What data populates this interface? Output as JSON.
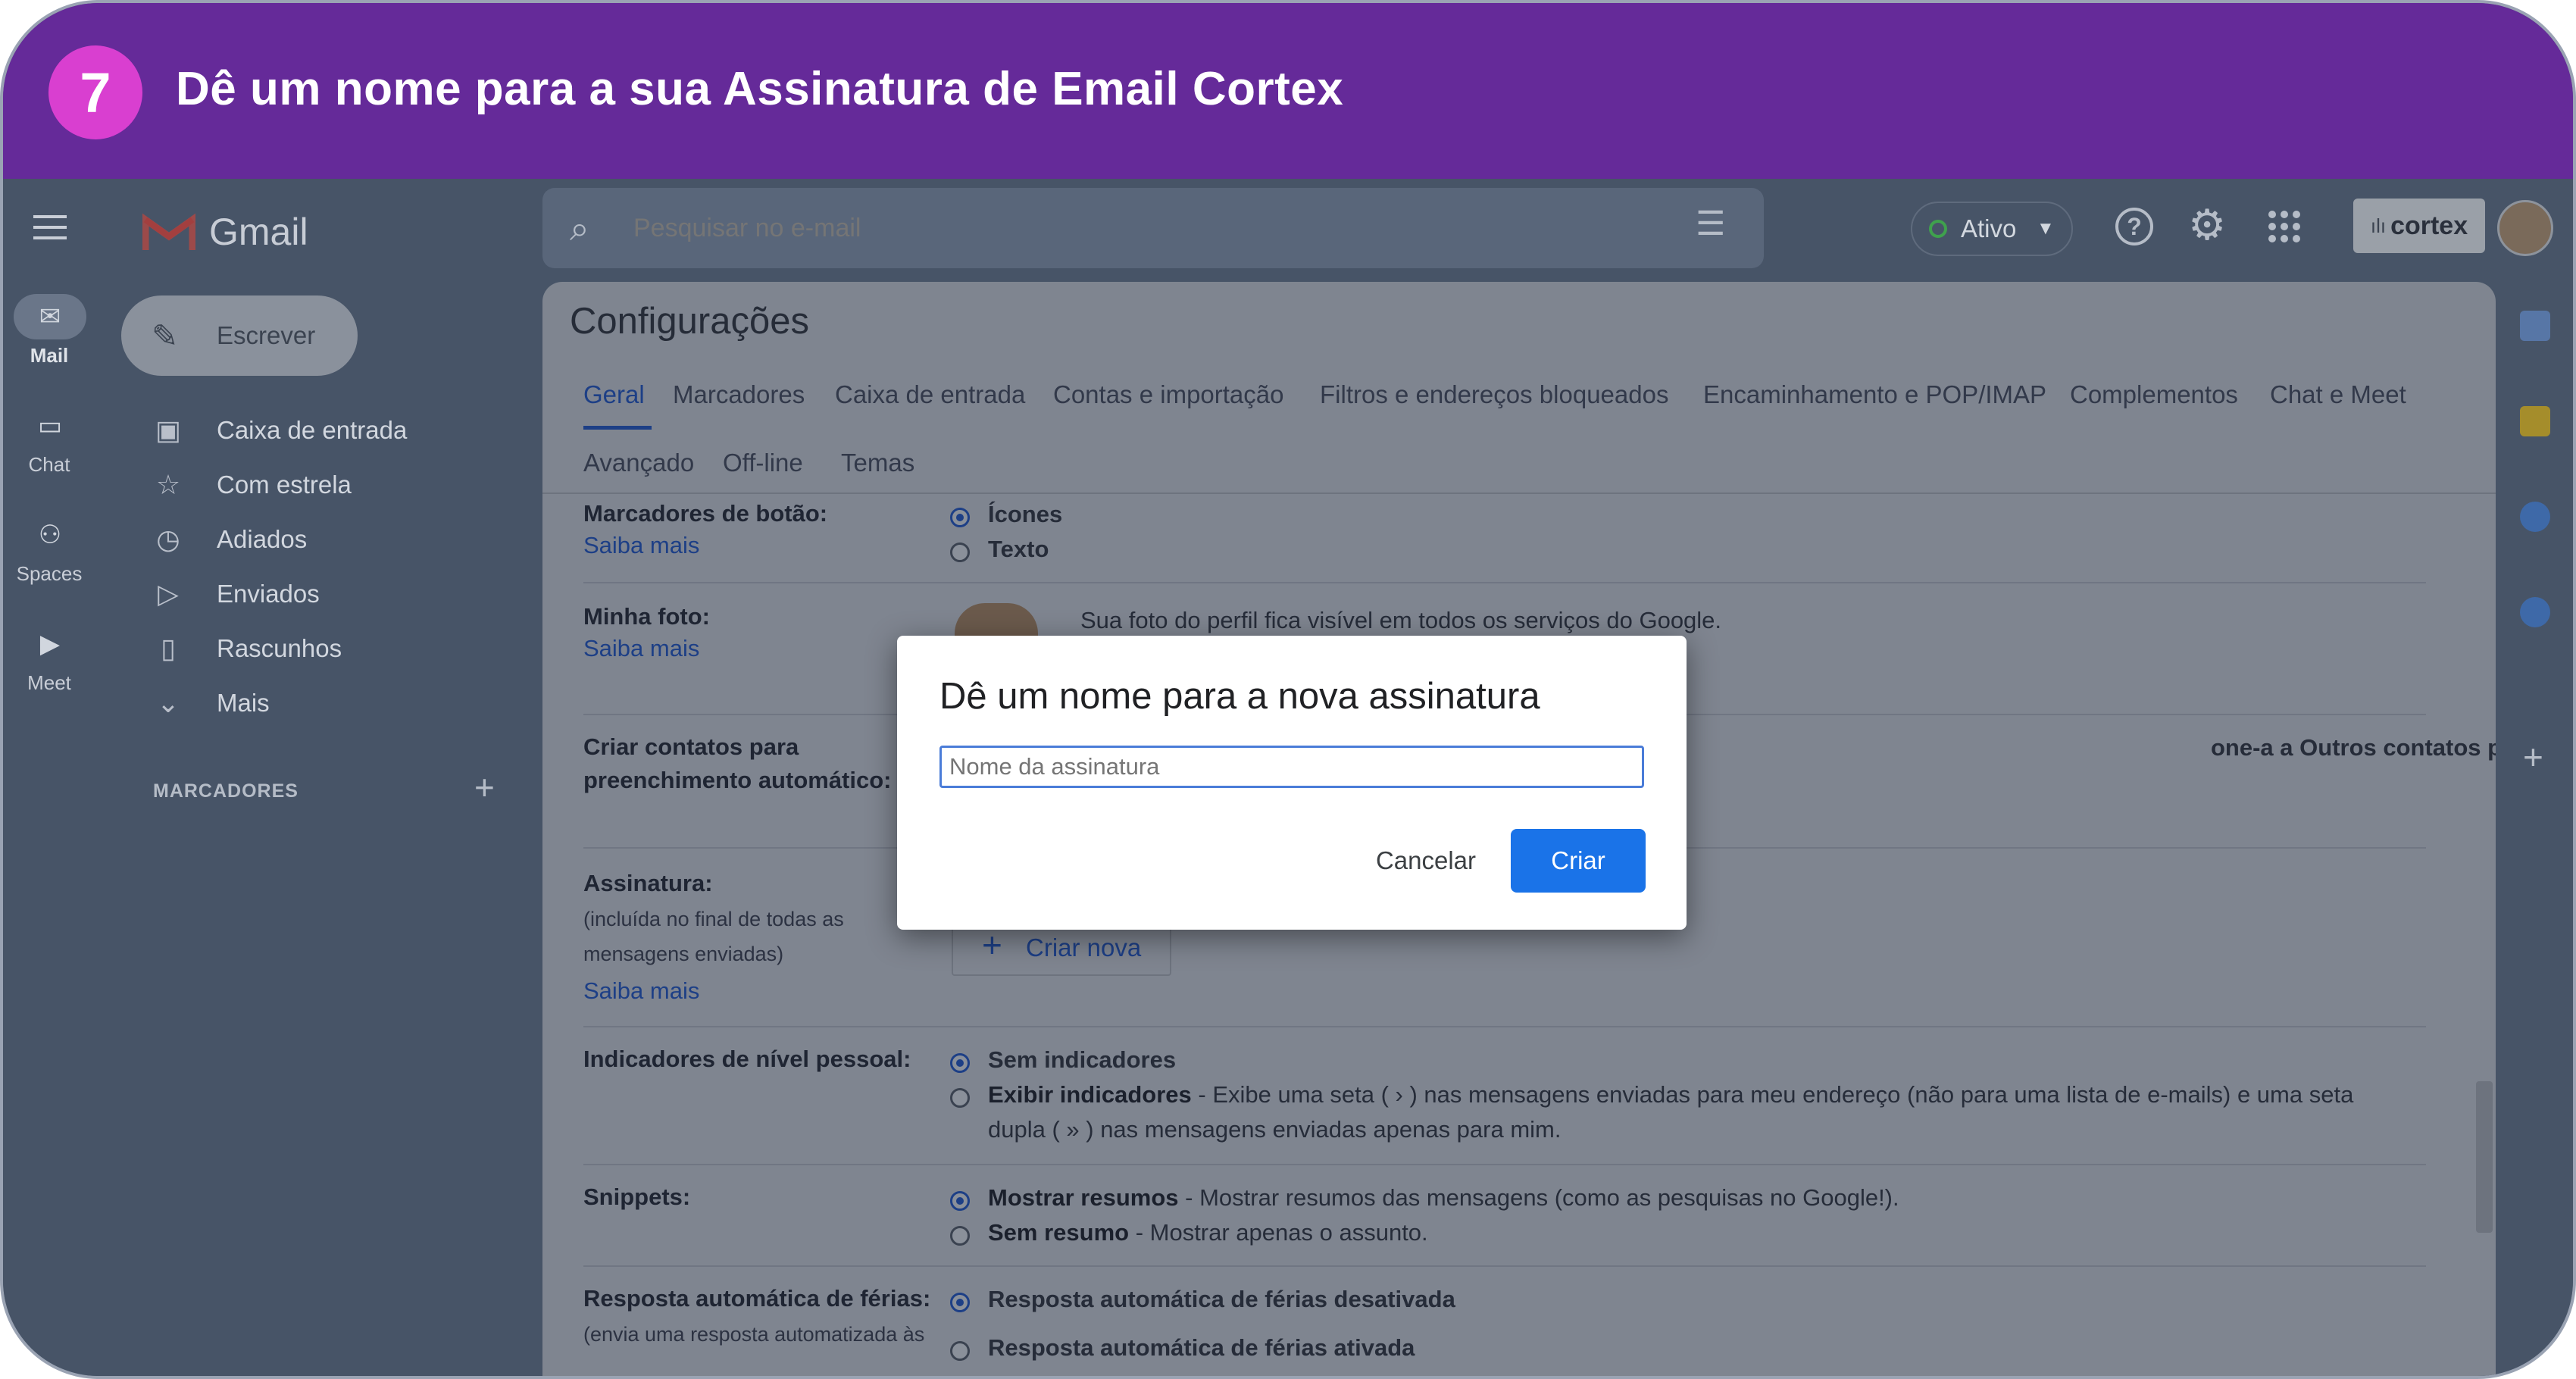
{
  "banner": {
    "step": "7",
    "title": "Dê um nome para a sua Assinatura de Email Cortex"
  },
  "rail": {
    "items": [
      {
        "label": "Mail"
      },
      {
        "label": "Chat"
      },
      {
        "label": "Spaces"
      },
      {
        "label": "Meet"
      }
    ]
  },
  "gmail": {
    "logo_text": "Gmail",
    "compose": "Escrever"
  },
  "nav": {
    "items": [
      {
        "label": "Caixa de entrada"
      },
      {
        "label": "Com estrela"
      },
      {
        "label": "Adiados"
      },
      {
        "label": "Enviados"
      },
      {
        "label": "Rascunhos"
      },
      {
        "label": "Mais"
      }
    ],
    "labels_header": "MARCADORES"
  },
  "search": {
    "placeholder": "Pesquisar no e-mail"
  },
  "topbar": {
    "status": "Ativo",
    "brand": "cortex"
  },
  "settings": {
    "title": "Configurações",
    "tabs": [
      "Geral",
      "Marcadores",
      "Caixa de entrada",
      "Contas e importação",
      "Filtros e endereços bloqueados",
      "Encaminhamento e POP/IMAP",
      "Complementos",
      "Chat e Meet",
      "Avançado",
      "Off-line",
      "Temas"
    ],
    "learn_more": "Saiba mais",
    "button_labels": {
      "label": "Marcadores de botão:",
      "opt1": "Ícones",
      "opt2": "Texto"
    },
    "photo": {
      "label": "Minha foto:",
      "text": "Sua foto do perfil fica visível em todos os serviços do Google."
    },
    "contacts": {
      "label1": "Criar contatos para",
      "label2": "preenchimento automático:",
      "text": "one-a a Outros contatos para que eu possa usar o recurso"
    },
    "signature": {
      "label": "Assinatura:",
      "sub1": "(incluída no final de todas as",
      "sub2": "mensagens enviadas)",
      "create": "Criar nova"
    },
    "personal": {
      "label": "Indicadores de nível pessoal:",
      "opt1": "Sem indicadores",
      "opt2_b": "Exibir indicadores",
      "opt2_text": " - Exibe uma seta ( › ) nas mensagens enviadas para meu endereço (não para uma lista de e-mails) e uma seta",
      "opt2_text2": "dupla ( » ) nas mensagens enviadas apenas para mim."
    },
    "snippets": {
      "label": "Snippets:",
      "opt1_b": "Mostrar resumos",
      "opt1_text": " - Mostrar resumos das mensagens (como as pesquisas no Google!).",
      "opt2_b": "Sem resumo",
      "opt2_text": " - Mostrar apenas o assunto."
    },
    "vacation": {
      "label": "Resposta automática de férias:",
      "sub": "(envia uma resposta automatizada às",
      "opt1": "Resposta automática de férias desativada",
      "opt2": "Resposta automática de férias ativada"
    }
  },
  "dialog": {
    "title": "Dê um nome para a nova assinatura",
    "placeholder": "Nome da assinatura",
    "cancel": "Cancelar",
    "create": "Criar"
  }
}
